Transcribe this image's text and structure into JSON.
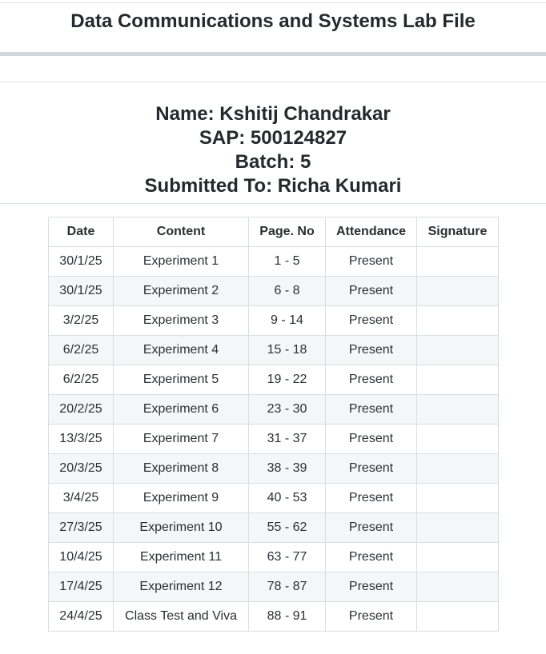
{
  "document": {
    "title": "Data Communications and Systems Lab File"
  },
  "info": {
    "name": "Name: Kshitij Chandrakar",
    "sap": "SAP: 500124827",
    "batch": "Batch: 5",
    "submitted_to": "Submitted To: Richa Kumari"
  },
  "table": {
    "headers": [
      "Date",
      "Content",
      "Page. No",
      "Attendance",
      "Signature"
    ],
    "rows": [
      {
        "date": "30/1/25",
        "content": "Experiment 1",
        "page": "1 - 5",
        "attendance": "Present",
        "signature": ""
      },
      {
        "date": "30/1/25",
        "content": "Experiment 2",
        "page": "6 - 8",
        "attendance": "Present",
        "signature": ""
      },
      {
        "date": "3/2/25",
        "content": "Experiment 3",
        "page": "9 - 14",
        "attendance": "Present",
        "signature": ""
      },
      {
        "date": "6/2/25",
        "content": "Experiment 4",
        "page": "15 - 18",
        "attendance": "Present",
        "signature": ""
      },
      {
        "date": "6/2/25",
        "content": "Experiment 5",
        "page": "19 - 22",
        "attendance": "Present",
        "signature": ""
      },
      {
        "date": "20/2/25",
        "content": "Experiment 6",
        "page": "23 - 30",
        "attendance": "Present",
        "signature": ""
      },
      {
        "date": "13/3/25",
        "content": "Experiment 7",
        "page": "31 - 37",
        "attendance": "Present",
        "signature": ""
      },
      {
        "date": "20/3/25",
        "content": "Experiment 8",
        "page": "38 - 39",
        "attendance": "Present",
        "signature": ""
      },
      {
        "date": "3/4/25",
        "content": "Experiment 9",
        "page": "40 - 53",
        "attendance": "Present",
        "signature": ""
      },
      {
        "date": "27/3/25",
        "content": "Experiment 10",
        "page": "55 - 62",
        "attendance": "Present",
        "signature": ""
      },
      {
        "date": "10/4/25",
        "content": "Experiment 11",
        "page": "63 - 77",
        "attendance": "Present",
        "signature": ""
      },
      {
        "date": "17/4/25",
        "content": "Experiment 12",
        "page": "78 - 87",
        "attendance": "Present",
        "signature": ""
      },
      {
        "date": "24/4/25",
        "content": "Class Test and Viva",
        "page": "88 - 91",
        "attendance": "Present",
        "signature": ""
      }
    ]
  }
}
